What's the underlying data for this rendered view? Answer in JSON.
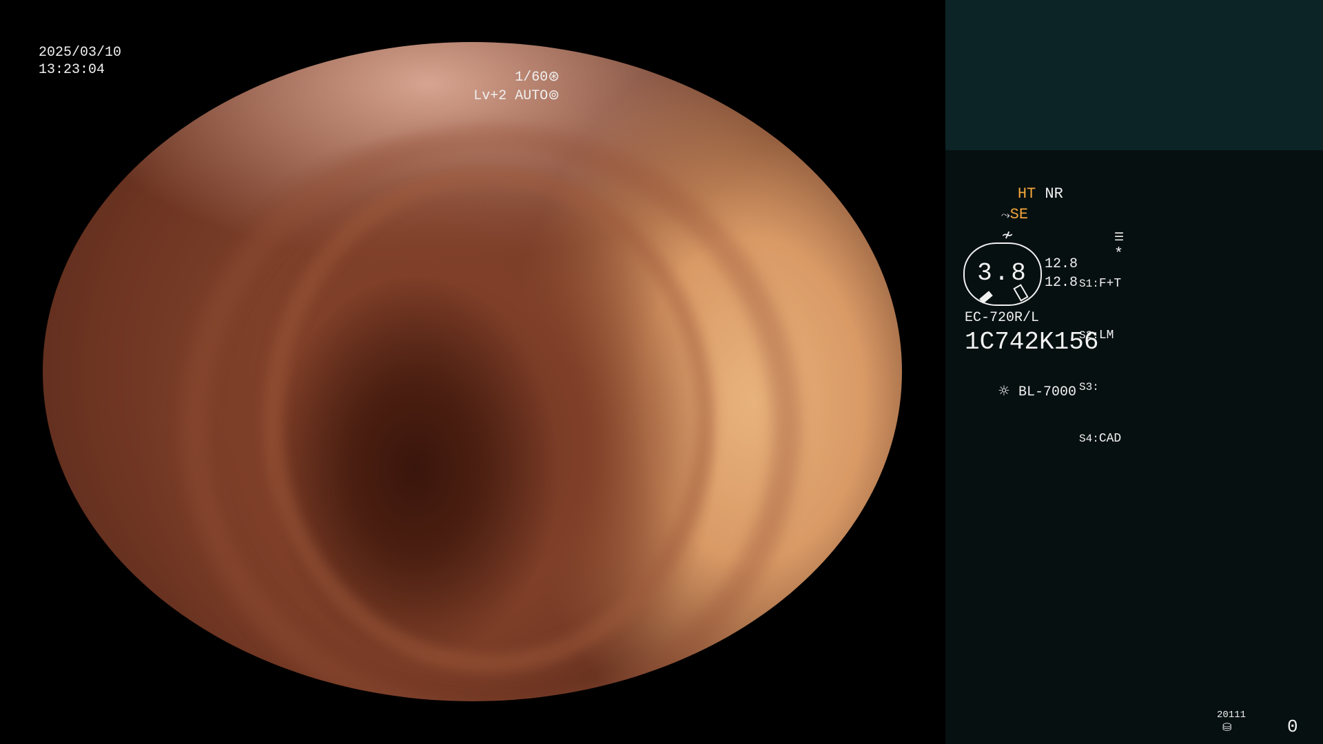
{
  "overlay": {
    "date": "2025/03/10",
    "time": "13:23:04",
    "shutter_speed": "1/60",
    "shutter_icon": "aperture-icon",
    "level": "Lv+2",
    "exposure_mode": "AUTO",
    "exposure_icon": "iris-icon"
  },
  "panel": {
    "ht_label": "HT",
    "nr_label": "NR",
    "se_label": "SE",
    "asterisk": "*",
    "gauge_value": "3.8",
    "reading_1": "12.8",
    "reading_2": "12.8",
    "switches": [
      {
        "key": "S1:",
        "value": "F+T"
      },
      {
        "key": "S2:",
        "value": "LM"
      },
      {
        "key": "S3:",
        "value": ""
      },
      {
        "key": "S4:",
        "value": "CAD"
      }
    ],
    "model": "EC-720R/L",
    "serial": "1C742K156",
    "light_source": "BL-7000",
    "footer_code": "20111",
    "footer_count": "0"
  },
  "colors": {
    "panel_bg": "#071011",
    "panel_top_bg": "#0c2425",
    "accent_orange": "#f2a63c"
  }
}
